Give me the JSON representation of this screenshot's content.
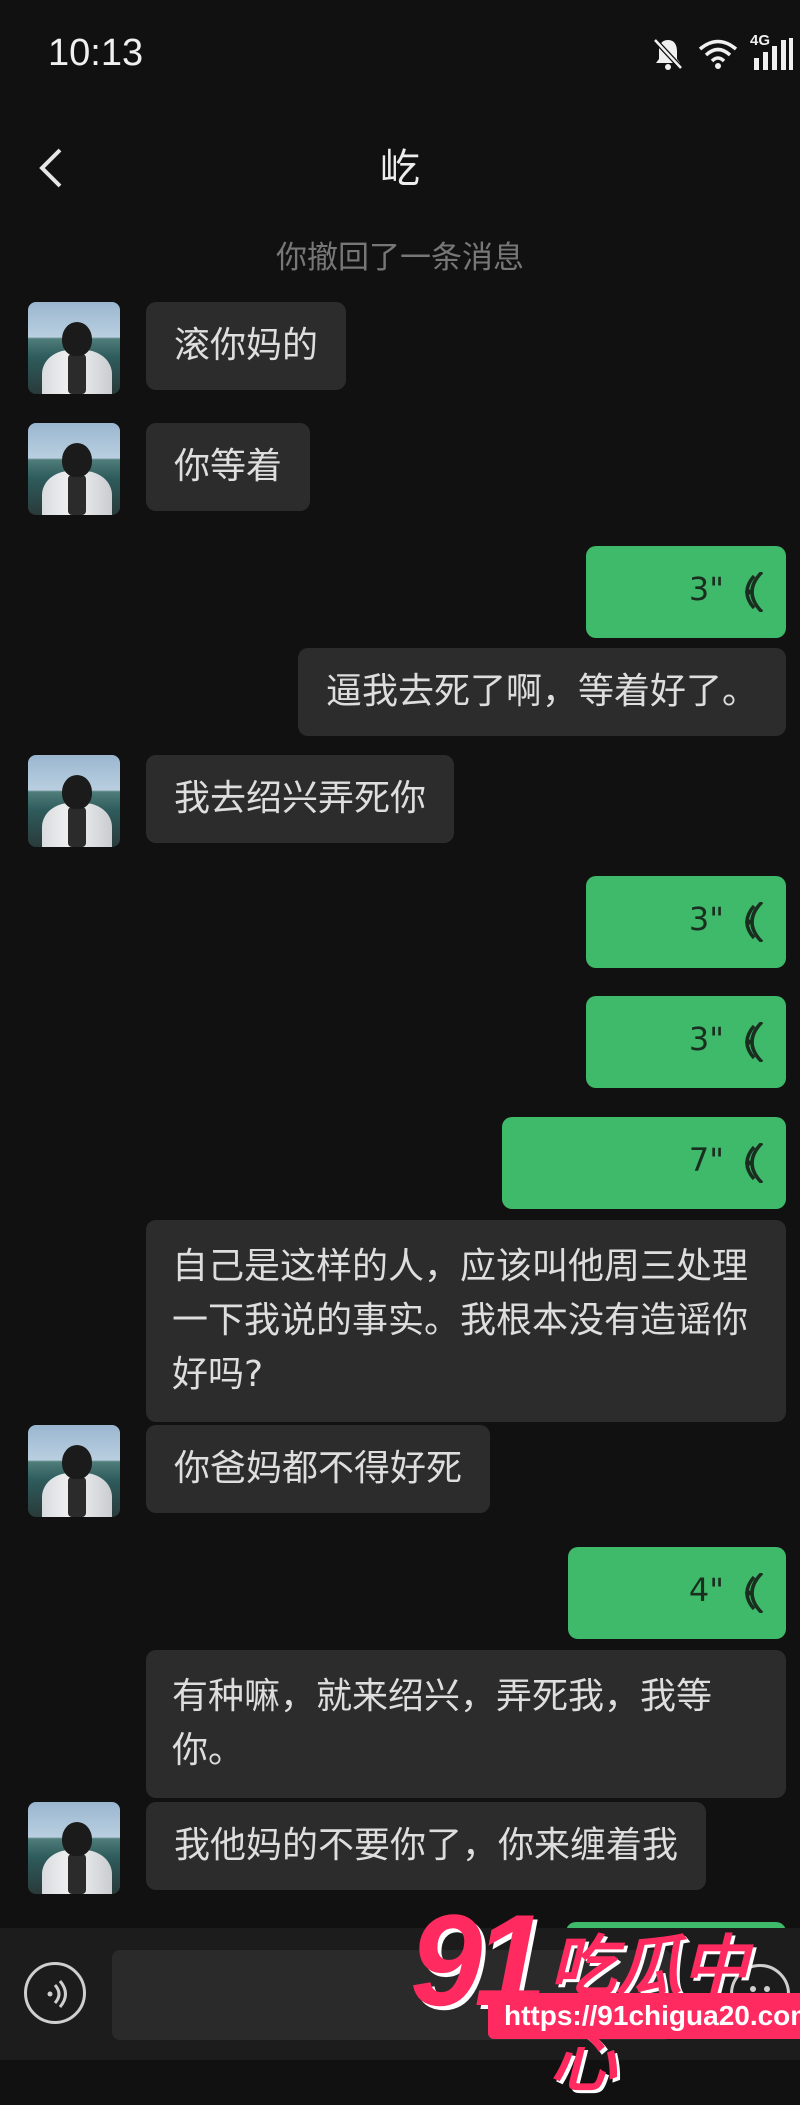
{
  "status_bar": {
    "time": "10:13",
    "network": "4G"
  },
  "header": {
    "title": "屹"
  },
  "system_message": "你撤回了一条消息",
  "messages": {
    "m1": {
      "text": "滚你妈的"
    },
    "m2": {
      "text": "你等着"
    },
    "v1": {
      "duration": "3\""
    },
    "m3": {
      "text": "逼我去死了啊，等着好了。"
    },
    "m4": {
      "text": "我去绍兴弄死你"
    },
    "v2": {
      "duration": "3\""
    },
    "v3": {
      "duration": "3\""
    },
    "v4": {
      "duration": "7\""
    },
    "m5": {
      "text": "自己是这样的人，应该叫他周三处理一下我说的事实。我根本没有造谣你好吗?"
    },
    "m6": {
      "text": "你爸妈都不得好死"
    },
    "v5": {
      "duration": "4\""
    },
    "m7": {
      "text": "有种嘛，就来绍兴，弄死我，我等你。"
    },
    "m8": {
      "text": "我他妈的不要你了，你来缠着我"
    }
  },
  "watermark": {
    "logo_number": "91",
    "logo_text": "吃瓜中心",
    "url": "https://91chigua20.com"
  },
  "colors": {
    "background": "#111111",
    "bubble_in": "#2c2c2c",
    "bubble_out_voice": "#3fb96a",
    "watermark": "#ff2a5f"
  }
}
